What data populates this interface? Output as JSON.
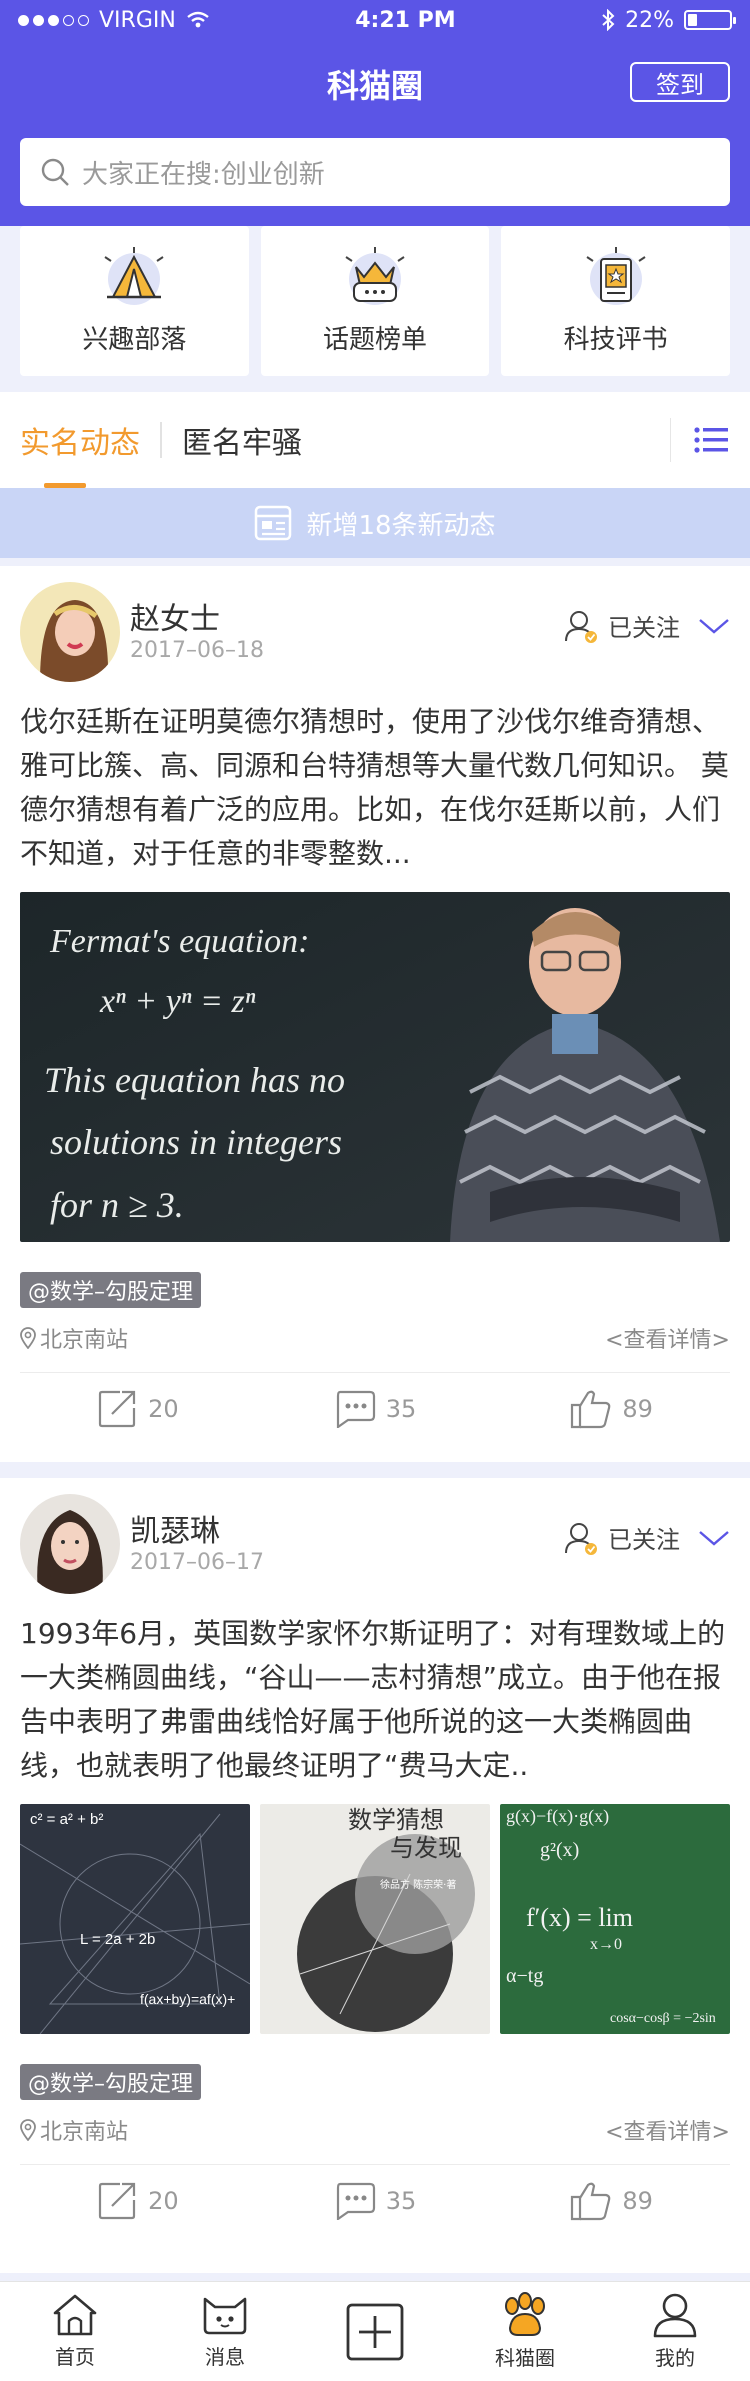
{
  "status": {
    "carrier": "VIRGIN",
    "time": "4:21 PM",
    "battery": "22%",
    "battery_level": 0.22
  },
  "header": {
    "title": "科猫圈",
    "checkin_label": "签到"
  },
  "search": {
    "placeholder": "大家正在搜:创业创新"
  },
  "categories": [
    {
      "label": "兴趣部落",
      "icon": "tent-icon"
    },
    {
      "label": "话题榜单",
      "icon": "crown-chat-icon"
    },
    {
      "label": "科技评书",
      "icon": "book-star-icon"
    }
  ],
  "tabs": [
    {
      "label": "实名动态",
      "active": true
    },
    {
      "label": "匿名牢骚",
      "active": false
    }
  ],
  "notice": "新增18条新动态",
  "posts": [
    {
      "name": "赵女士",
      "date": "2017–06–18",
      "follow_label": "已关注",
      "text": "伐尔廷斯在证明莫德尔猜想时，使用了沙伐尔维奇猜想、雅可比簇、高、同源和台特猜想等大量代数几何知识。   莫德尔猜想有着广泛的应用。比如，在伐尔廷斯以前，人们不知道，对于任意的非零整数...",
      "image_text": [
        "Fermat's equation:",
        "xⁿ + yⁿ = zⁿ",
        "This equation has no",
        "solutions in integers",
        "for n ≥ 3."
      ],
      "tag": "@数学–勾股定理",
      "location": "北京南站",
      "detail_link": "<查看详情>",
      "shares": "20",
      "comments": "35",
      "likes": "89"
    },
    {
      "name": "凯瑟琳",
      "date": "2017–06–17",
      "follow_label": "已关注",
      "text": "1993年6月，英国数学家怀尔斯证明了：对有理数域上的一大类椭圆曲线，“谷山——志村猜想”成立。由于他在报告中表明了弗雷曲线恰好属于他所说的这一大类椭圆曲线，也就表明了他最终证明了“费马大定..",
      "images": [
        {
          "lines": [
            "c² = a² + b²",
            "L = 2a + 2b",
            "f(ax+by)=af(x)+"
          ]
        },
        {
          "title": "数学猜想",
          "subtitle": "与发现",
          "authors": "徐品方 陈宗荣·著"
        },
        {
          "lines": [
            "g(x)−f(x)·g(x)",
            "g²(x)",
            "f′(x) = lim",
            "x→0",
            "α−tg",
            "cosα−cosβ = −2sin"
          ]
        }
      ],
      "tag": "@数学–勾股定理",
      "location": "北京南站",
      "detail_link": "<查看详情>",
      "shares": "20",
      "comments": "35",
      "likes": "89"
    }
  ],
  "bottom_nav": [
    {
      "label": "首页",
      "icon": "home-icon"
    },
    {
      "label": "消息",
      "icon": "message-cat-icon"
    },
    {
      "label": "",
      "icon": "add-icon"
    },
    {
      "label": "科猫圈",
      "icon": "paw-icon",
      "active": true
    },
    {
      "label": "我的",
      "icon": "user-icon"
    }
  ],
  "colors": {
    "brand": "#5b55e6",
    "accent": "#f29a2e",
    "notice": "#c9d5f6"
  }
}
